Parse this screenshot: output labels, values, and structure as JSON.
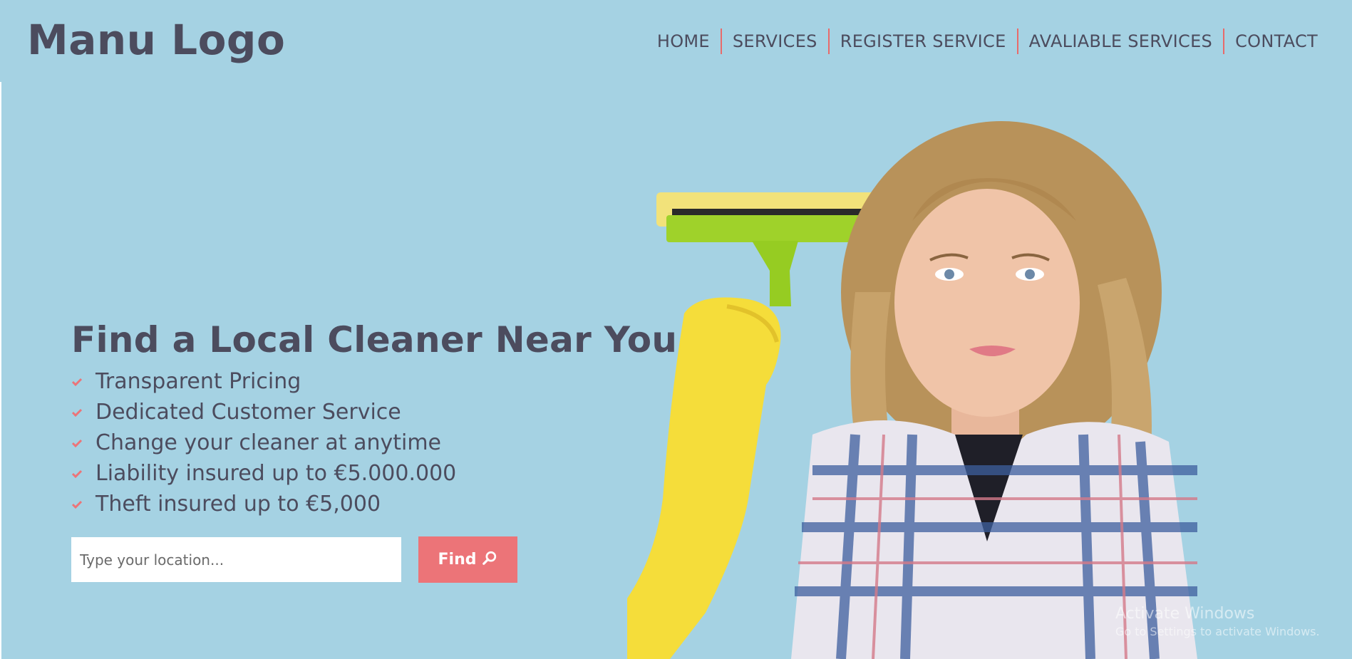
{
  "header": {
    "logo": "Manu Logo",
    "nav": [
      {
        "label": "HOME"
      },
      {
        "label": "SERVICES"
      },
      {
        "label": "REGISTER SERVICE"
      },
      {
        "label": "AVALIABLE SERVICES"
      },
      {
        "label": "CONTACT"
      }
    ]
  },
  "hero": {
    "title": "Find a Local Cleaner Near You",
    "features": [
      "Transparent Pricing",
      "Dedicated Customer Service",
      "Change your cleaner at anytime",
      "Liability insured up to €5.000.000",
      "Theft insured up to €5,000"
    ],
    "search": {
      "placeholder": "Type your location...",
      "value": "",
      "button_label": "Find",
      "button_icon": "search-icon"
    }
  },
  "watermark": {
    "line1": "Activate Windows",
    "line2": "Go to Settings to activate Windows."
  },
  "colors": {
    "background": "#a5d2e3",
    "text": "#4c4c5e",
    "accent": "#ec7478"
  }
}
